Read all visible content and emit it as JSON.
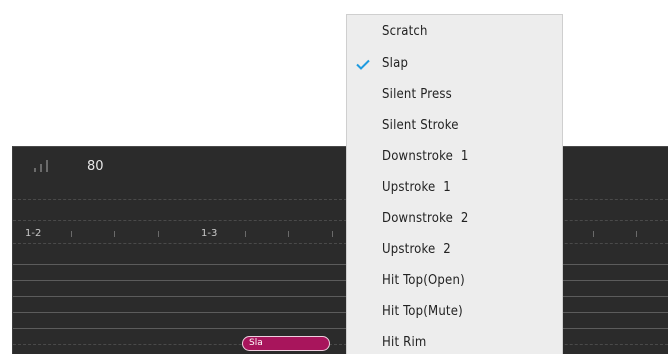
{
  "editor": {
    "velocity_value": "80",
    "bar_labels": [
      "1-2",
      "1-3"
    ],
    "note_label": "Sla",
    "note_color": "#a8155c",
    "background_color": "#2b2b2b"
  },
  "menu": {
    "accent_color": "#1e9be0",
    "selected_index": 1,
    "items": [
      {
        "label": "Scratch",
        "checked": false
      },
      {
        "label": "Slap",
        "checked": true
      },
      {
        "label": "Silent Press",
        "checked": false
      },
      {
        "label": "Silent Stroke",
        "checked": false
      },
      {
        "label": "Downstroke  1",
        "checked": false
      },
      {
        "label": "Upstroke  1",
        "checked": false
      },
      {
        "label": "Downstroke  2",
        "checked": false
      },
      {
        "label": "Upstroke  2",
        "checked": false
      },
      {
        "label": "Hit Top(Open)",
        "checked": false
      },
      {
        "label": "Hit Top(Mute)",
        "checked": false
      },
      {
        "label": "Hit Rim",
        "checked": false
      }
    ]
  }
}
